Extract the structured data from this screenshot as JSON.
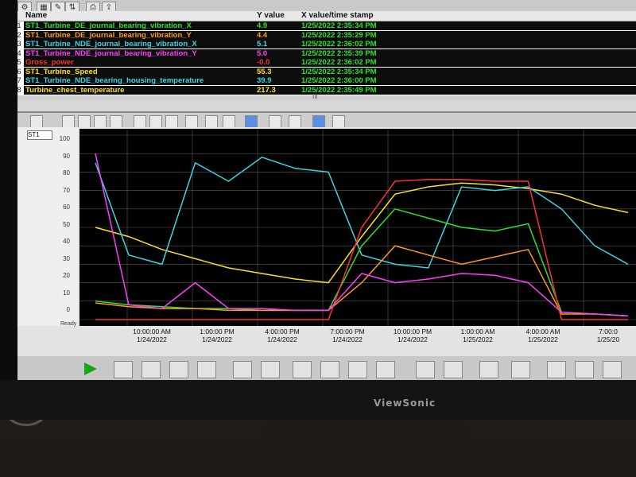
{
  "table": {
    "headers": {
      "name": "Name",
      "y": "Y value",
      "x": "X value/time stamp"
    },
    "rows": [
      {
        "num": "1",
        "name": "ST1_Turbine_DE_journal_bearing_vibration_X",
        "y": "4.9",
        "x": "1/25/2022 2:35:34 PM",
        "color": "#2ee02e"
      },
      {
        "num": "2",
        "name": "ST1_Turbine_DE_journal_bearing_vibration_Y",
        "y": "4.4",
        "x": "1/25/2022 2:35:29 PM",
        "color": "#ff9a1a"
      },
      {
        "num": "3",
        "name": "ST1_Turbine_NDE_journal_bearing_vibration_X",
        "y": "5.1",
        "x": "1/25/2022 2:36:02 PM",
        "color": "#3ad6e6"
      },
      {
        "num": "4",
        "name": "ST1_Turbine_NDE_journal_bearing_vibration_Y",
        "y": "5.0",
        "x": "1/25/2022 2:35:39 PM",
        "color": "#ff3cff"
      },
      {
        "num": "5",
        "name": "Gross_power",
        "y": "-0.0",
        "x": "1/25/2022 2:36:02 PM",
        "color": "#ff3030"
      },
      {
        "num": "6",
        "name": "ST1_Turbine_Speed",
        "y": "55.3",
        "x": "1/25/2022 2:35:34 PM",
        "color": "#ffe020"
      },
      {
        "num": "7",
        "name": "ST1_Turbine_NDE_bearing_housing_temperature",
        "y": "39.9",
        "x": "1/25/2022 2:36:00 PM",
        "color": "#3ad6e6"
      },
      {
        "num": "8",
        "name": "Turbine_chest_temperature",
        "y": "217.3",
        "x": "1/25/2022 2:35:49 PM",
        "color": "#ffe020"
      }
    ]
  },
  "scroll_marker": "III",
  "selector": "ST1",
  "status": "Ready",
  "brand": "ViewSonic",
  "chart_data": {
    "type": "line",
    "yticks": [
      "100",
      "90",
      "80",
      "70",
      "60",
      "50",
      "40",
      "30",
      "20",
      "10",
      "0"
    ],
    "ylim": [
      0,
      100
    ],
    "xticks": [
      {
        "time": "10:00:00 AM",
        "date": "1/24/2022"
      },
      {
        "time": "1:00:00 PM",
        "date": "1/24/2022"
      },
      {
        "time": "4:00:00 PM",
        "date": "1/24/2022"
      },
      {
        "time": "7:00:00 PM",
        "date": "1/24/2022"
      },
      {
        "time": "10:00:00 PM",
        "date": "1/24/2022"
      },
      {
        "time": "1:00:00 AM",
        "date": "1/25/2022"
      },
      {
        "time": "4:00:00 AM",
        "date": "1/25/2022"
      },
      {
        "time": "7:00:0",
        "date": "1/25/20"
      }
    ],
    "series": [
      {
        "color": "#ffe020",
        "values": [
          50,
          45,
          38,
          33,
          28,
          25,
          22,
          20,
          45,
          68,
          72,
          74,
          73,
          71,
          68,
          62,
          58
        ]
      },
      {
        "color": "#3ad6e6",
        "values": [
          85,
          35,
          30,
          85,
          75,
          88,
          82,
          80,
          35,
          30,
          28,
          72,
          70,
          72,
          60,
          40,
          30
        ]
      },
      {
        "color": "#2ee02e",
        "values": [
          10,
          8,
          7,
          6,
          6,
          5,
          5,
          5,
          40,
          60,
          55,
          50,
          48,
          52,
          4,
          3,
          2
        ]
      },
      {
        "color": "#ff9a1a",
        "values": [
          9,
          7,
          6,
          6,
          5,
          5,
          5,
          5,
          20,
          40,
          35,
          30,
          34,
          38,
          3,
          3,
          2
        ]
      },
      {
        "color": "#ff3030",
        "values": [
          0,
          0,
          0,
          0,
          0,
          0,
          0,
          0,
          50,
          75,
          76,
          76,
          75,
          75,
          0,
          0,
          0
        ]
      },
      {
        "color": "#ff3cff",
        "values": [
          90,
          8,
          6,
          20,
          6,
          6,
          5,
          5,
          25,
          20,
          22,
          25,
          24,
          20,
          4,
          3,
          2
        ]
      }
    ]
  }
}
